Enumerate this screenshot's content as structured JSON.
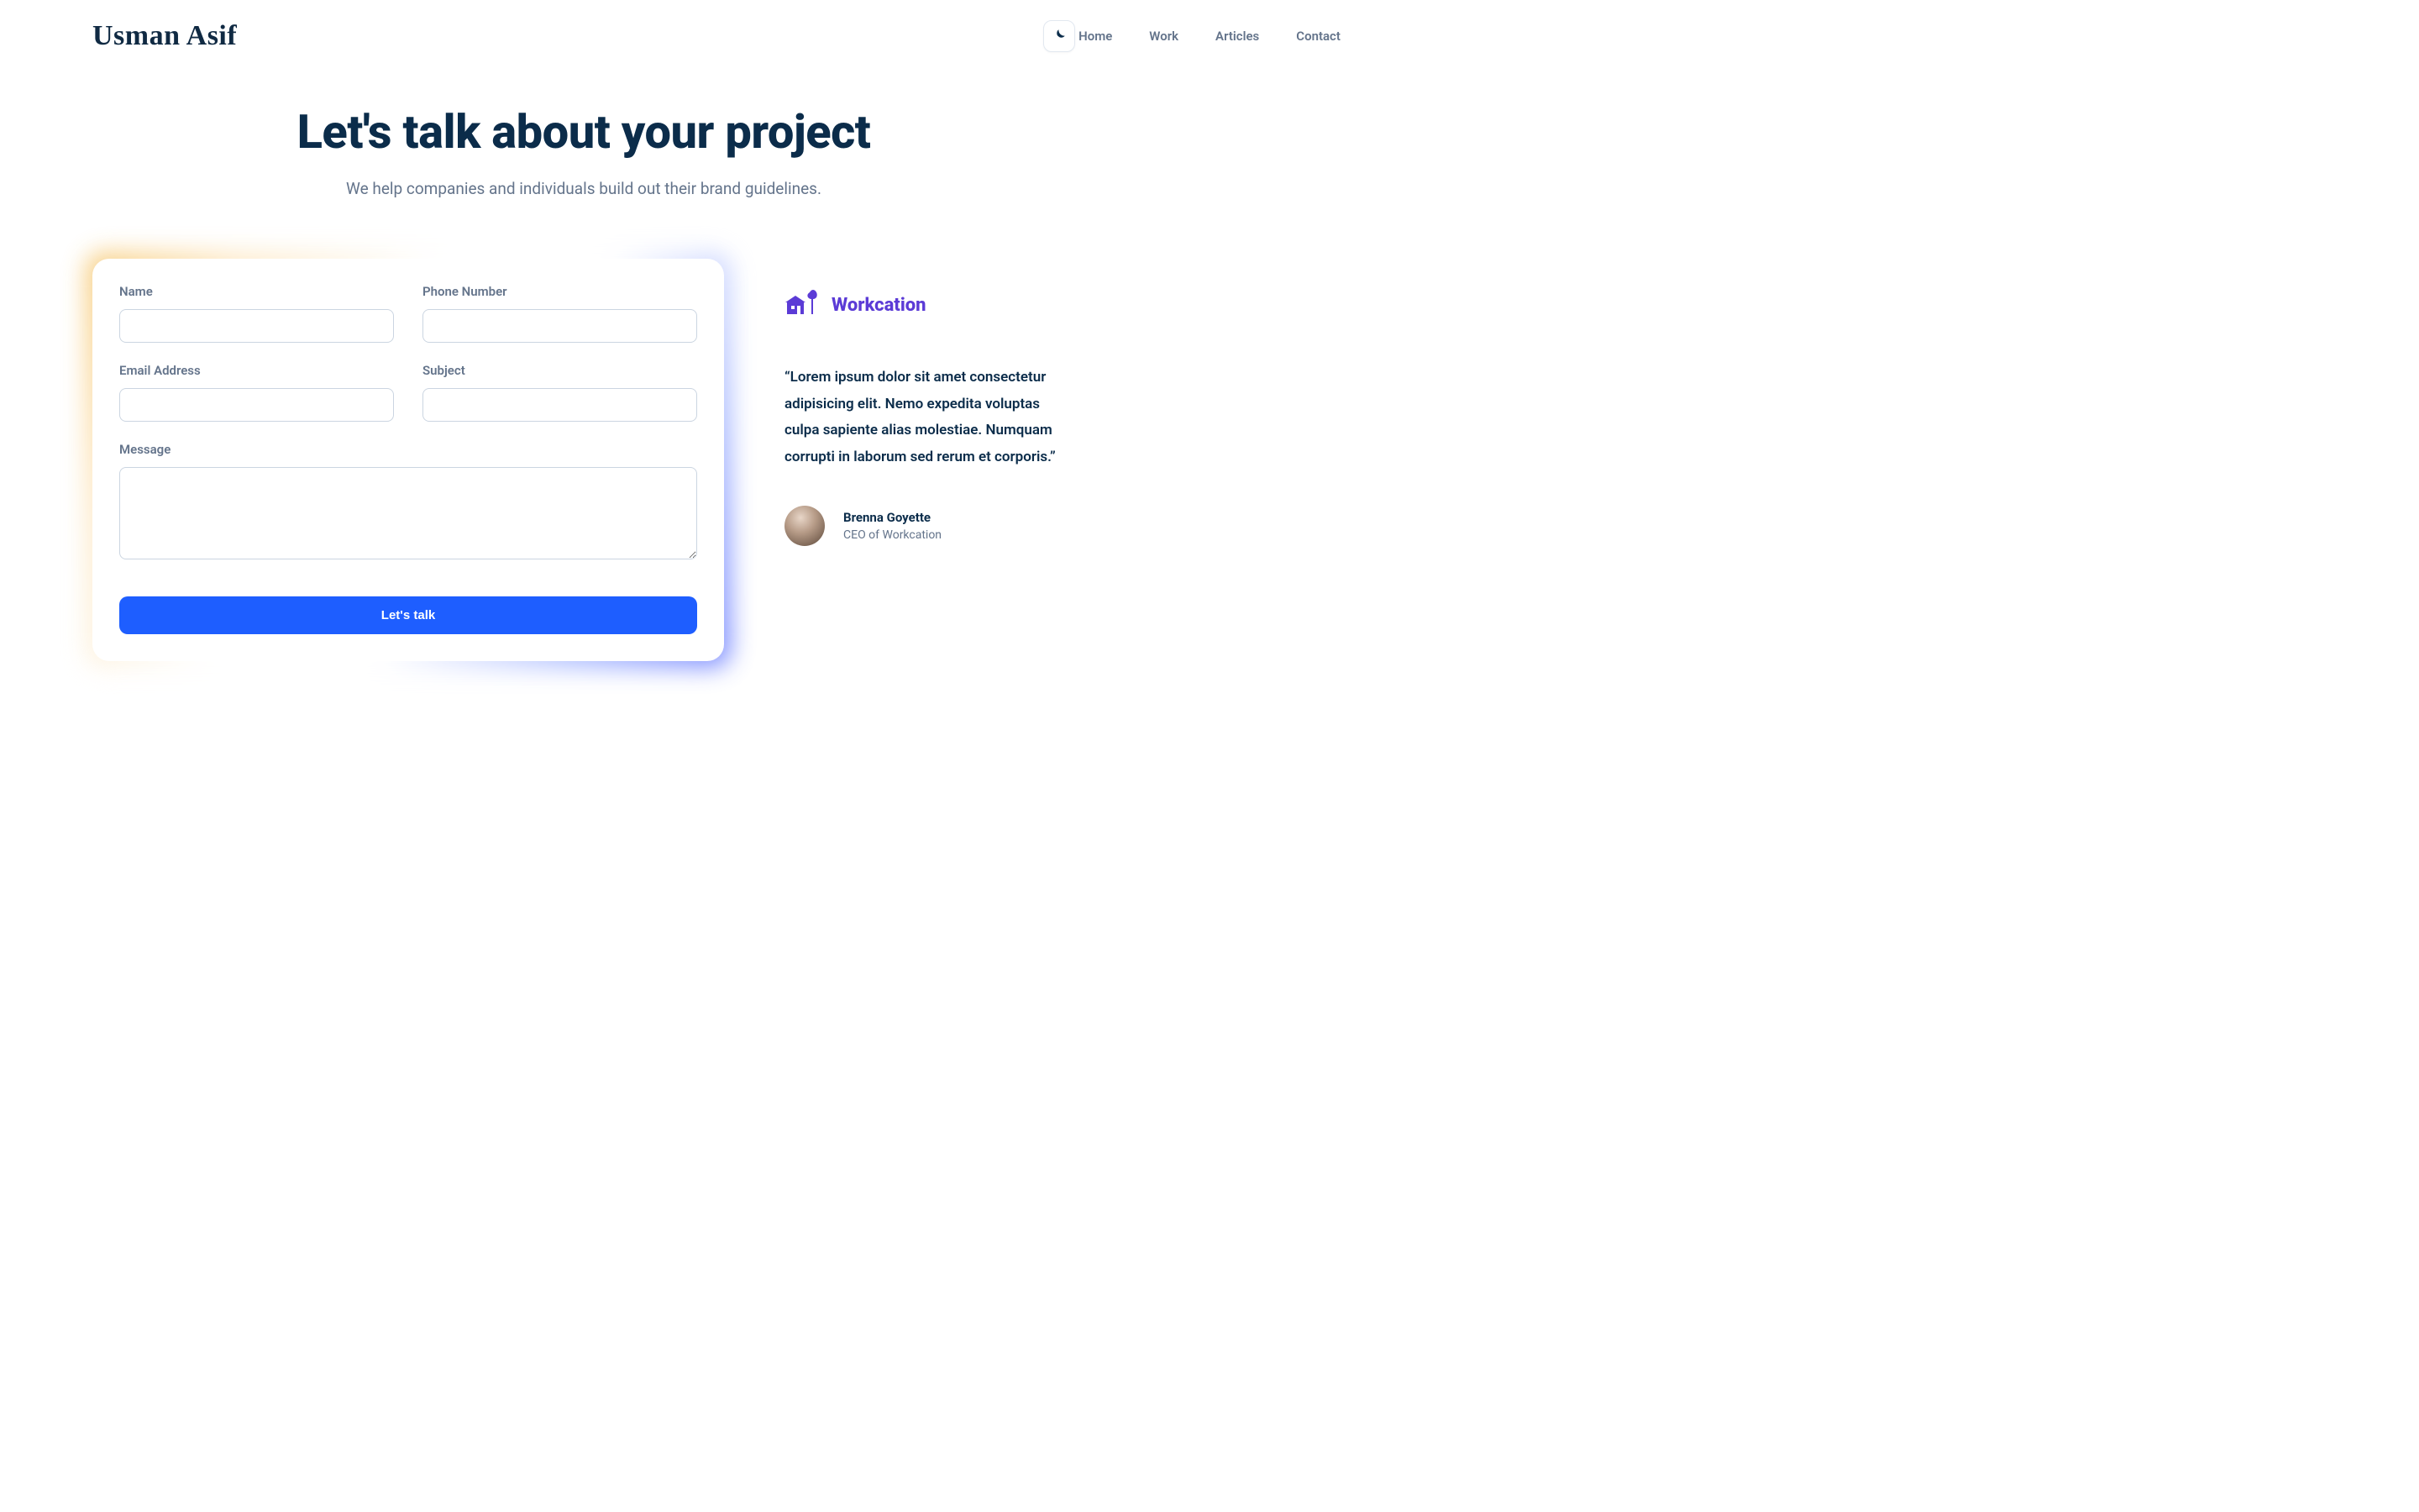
{
  "nav": {
    "logo": "Usman Asif",
    "links": [
      "Home",
      "Work",
      "Articles",
      "Contact"
    ]
  },
  "header": {
    "title": "Let's talk about your project",
    "subtitle": "We help companies and individuals build out their brand guidelines."
  },
  "form": {
    "fields": {
      "name": {
        "label": "Name",
        "value": ""
      },
      "phone": {
        "label": "Phone Number",
        "value": ""
      },
      "email": {
        "label": "Email Address",
        "value": ""
      },
      "subject": {
        "label": "Subject",
        "value": ""
      },
      "message": {
        "label": "Message",
        "value": ""
      }
    },
    "submit_label": "Let's talk"
  },
  "testimonial": {
    "brand": "Workcation",
    "quote": "“Lorem ipsum dolor sit amet consectetur adipisicing elit. Nemo expedita voluptas culpa sapiente alias molestiae. Numquam corrupti in laborum sed rerum et corporis.”",
    "author": {
      "name": "Brenna Goyette",
      "title": "CEO of Workcation"
    }
  },
  "colors": {
    "brand_purple": "#5b3bd6",
    "primary_blue": "#1e5eff",
    "text_dark": "#0b2c4a",
    "text_muted": "#64748b"
  }
}
